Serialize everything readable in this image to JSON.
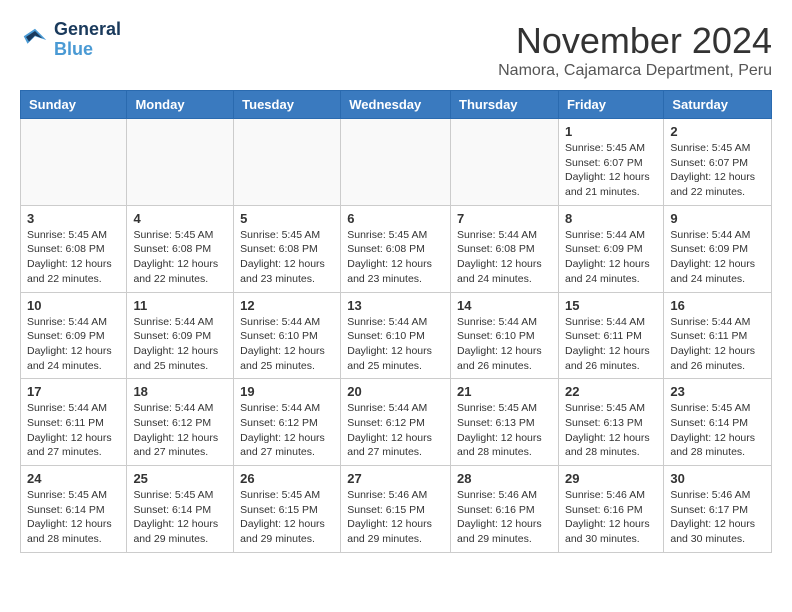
{
  "logo": {
    "line1": "General",
    "line2": "Blue"
  },
  "title": "November 2024",
  "location": "Namora, Cajamarca Department, Peru",
  "weekdays": [
    "Sunday",
    "Monday",
    "Tuesday",
    "Wednesday",
    "Thursday",
    "Friday",
    "Saturday"
  ],
  "weeks": [
    [
      {
        "day": "",
        "info": ""
      },
      {
        "day": "",
        "info": ""
      },
      {
        "day": "",
        "info": ""
      },
      {
        "day": "",
        "info": ""
      },
      {
        "day": "",
        "info": ""
      },
      {
        "day": "1",
        "info": "Sunrise: 5:45 AM\nSunset: 6:07 PM\nDaylight: 12 hours and 21 minutes."
      },
      {
        "day": "2",
        "info": "Sunrise: 5:45 AM\nSunset: 6:07 PM\nDaylight: 12 hours and 22 minutes."
      }
    ],
    [
      {
        "day": "3",
        "info": "Sunrise: 5:45 AM\nSunset: 6:08 PM\nDaylight: 12 hours and 22 minutes."
      },
      {
        "day": "4",
        "info": "Sunrise: 5:45 AM\nSunset: 6:08 PM\nDaylight: 12 hours and 22 minutes."
      },
      {
        "day": "5",
        "info": "Sunrise: 5:45 AM\nSunset: 6:08 PM\nDaylight: 12 hours and 23 minutes."
      },
      {
        "day": "6",
        "info": "Sunrise: 5:45 AM\nSunset: 6:08 PM\nDaylight: 12 hours and 23 minutes."
      },
      {
        "day": "7",
        "info": "Sunrise: 5:44 AM\nSunset: 6:08 PM\nDaylight: 12 hours and 24 minutes."
      },
      {
        "day": "8",
        "info": "Sunrise: 5:44 AM\nSunset: 6:09 PM\nDaylight: 12 hours and 24 minutes."
      },
      {
        "day": "9",
        "info": "Sunrise: 5:44 AM\nSunset: 6:09 PM\nDaylight: 12 hours and 24 minutes."
      }
    ],
    [
      {
        "day": "10",
        "info": "Sunrise: 5:44 AM\nSunset: 6:09 PM\nDaylight: 12 hours and 24 minutes."
      },
      {
        "day": "11",
        "info": "Sunrise: 5:44 AM\nSunset: 6:09 PM\nDaylight: 12 hours and 25 minutes."
      },
      {
        "day": "12",
        "info": "Sunrise: 5:44 AM\nSunset: 6:10 PM\nDaylight: 12 hours and 25 minutes."
      },
      {
        "day": "13",
        "info": "Sunrise: 5:44 AM\nSunset: 6:10 PM\nDaylight: 12 hours and 25 minutes."
      },
      {
        "day": "14",
        "info": "Sunrise: 5:44 AM\nSunset: 6:10 PM\nDaylight: 12 hours and 26 minutes."
      },
      {
        "day": "15",
        "info": "Sunrise: 5:44 AM\nSunset: 6:11 PM\nDaylight: 12 hours and 26 minutes."
      },
      {
        "day": "16",
        "info": "Sunrise: 5:44 AM\nSunset: 6:11 PM\nDaylight: 12 hours and 26 minutes."
      }
    ],
    [
      {
        "day": "17",
        "info": "Sunrise: 5:44 AM\nSunset: 6:11 PM\nDaylight: 12 hours and 27 minutes."
      },
      {
        "day": "18",
        "info": "Sunrise: 5:44 AM\nSunset: 6:12 PM\nDaylight: 12 hours and 27 minutes."
      },
      {
        "day": "19",
        "info": "Sunrise: 5:44 AM\nSunset: 6:12 PM\nDaylight: 12 hours and 27 minutes."
      },
      {
        "day": "20",
        "info": "Sunrise: 5:44 AM\nSunset: 6:12 PM\nDaylight: 12 hours and 27 minutes."
      },
      {
        "day": "21",
        "info": "Sunrise: 5:45 AM\nSunset: 6:13 PM\nDaylight: 12 hours and 28 minutes."
      },
      {
        "day": "22",
        "info": "Sunrise: 5:45 AM\nSunset: 6:13 PM\nDaylight: 12 hours and 28 minutes."
      },
      {
        "day": "23",
        "info": "Sunrise: 5:45 AM\nSunset: 6:14 PM\nDaylight: 12 hours and 28 minutes."
      }
    ],
    [
      {
        "day": "24",
        "info": "Sunrise: 5:45 AM\nSunset: 6:14 PM\nDaylight: 12 hours and 28 minutes."
      },
      {
        "day": "25",
        "info": "Sunrise: 5:45 AM\nSunset: 6:14 PM\nDaylight: 12 hours and 29 minutes."
      },
      {
        "day": "26",
        "info": "Sunrise: 5:45 AM\nSunset: 6:15 PM\nDaylight: 12 hours and 29 minutes."
      },
      {
        "day": "27",
        "info": "Sunrise: 5:46 AM\nSunset: 6:15 PM\nDaylight: 12 hours and 29 minutes."
      },
      {
        "day": "28",
        "info": "Sunrise: 5:46 AM\nSunset: 6:16 PM\nDaylight: 12 hours and 29 minutes."
      },
      {
        "day": "29",
        "info": "Sunrise: 5:46 AM\nSunset: 6:16 PM\nDaylight: 12 hours and 30 minutes."
      },
      {
        "day": "30",
        "info": "Sunrise: 5:46 AM\nSunset: 6:17 PM\nDaylight: 12 hours and 30 minutes."
      }
    ]
  ]
}
